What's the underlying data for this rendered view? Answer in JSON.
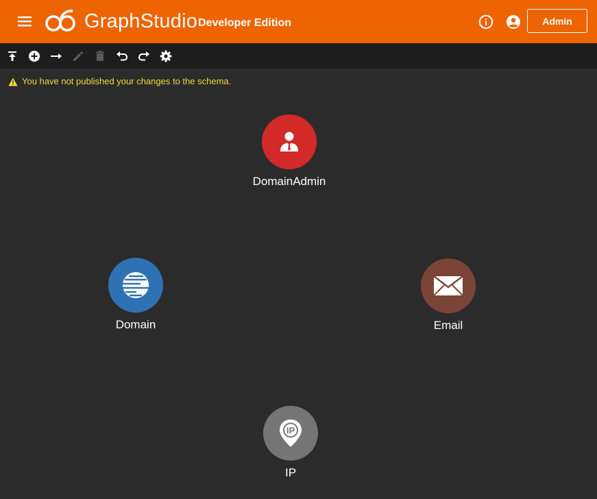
{
  "header": {
    "brand_part1": "Graph",
    "brand_part2": "Studio",
    "edition": "Developer Edition",
    "admin_label": "Admin"
  },
  "colors": {
    "header_bg": "#ee6402",
    "canvas_bg": "#2b2b2b",
    "toolbar_bg": "#1d1d1d",
    "warning_text": "#f2da3a"
  },
  "toolbar": {
    "tools": [
      {
        "icon": "publish-icon",
        "enabled": true
      },
      {
        "icon": "add-vertex-icon",
        "enabled": true
      },
      {
        "icon": "add-edge-icon",
        "enabled": true
      },
      {
        "icon": "edit-icon",
        "enabled": false
      },
      {
        "icon": "delete-icon",
        "enabled": false
      },
      {
        "icon": "undo-icon",
        "enabled": true
      },
      {
        "icon": "redo-icon",
        "enabled": true
      },
      {
        "icon": "settings-icon",
        "enabled": true
      }
    ]
  },
  "warning": {
    "text": "You have not published your changes to the schema."
  },
  "nodes": [
    {
      "label": "DomainAdmin",
      "icon": "person-icon",
      "color": "#d22929"
    },
    {
      "label": "Domain",
      "icon": "globe-icon",
      "color": "#2f72b4"
    },
    {
      "label": "Email",
      "icon": "envelope-icon",
      "color": "#7a4437"
    },
    {
      "label": "IP",
      "icon": "ip-pin-icon",
      "color": "#757575"
    }
  ]
}
